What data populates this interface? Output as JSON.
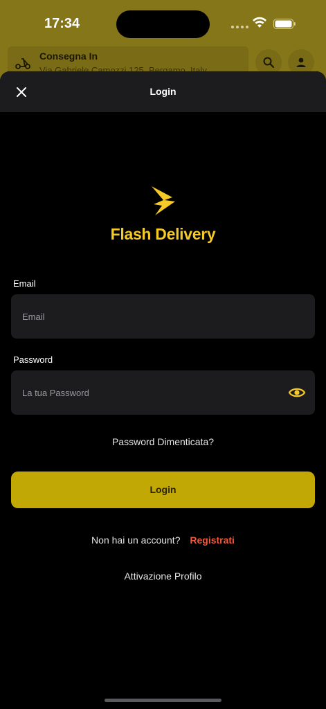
{
  "status_bar": {
    "time": "17:34"
  },
  "background_app": {
    "delivery_title": "Consegna In",
    "delivery_address": "Via Gabriele Camozzi 125, Bergamo, Italy"
  },
  "sheet": {
    "title": "Login",
    "brand_name": "Flash Delivery",
    "email_label": "Email",
    "email_placeholder": "Email",
    "email_value": "",
    "password_label": "Password",
    "password_placeholder": "La tua Password",
    "password_value": "",
    "forgot_password": "Password Dimenticata?",
    "login_button": "Login",
    "no_account": "Non hai un account?",
    "register_link": "Registrati",
    "activate_profile": "Attivazione Profilo"
  },
  "colors": {
    "brand_yellow": "#f5c928",
    "button_yellow": "#c2a805",
    "link_orange": "#ef5a3c",
    "field_bg": "#1c1c1e"
  },
  "icons": [
    "scooter-icon",
    "search-icon",
    "user-icon",
    "close-icon",
    "flash-logo-icon",
    "eye-icon",
    "wifi-icon",
    "battery-icon"
  ]
}
